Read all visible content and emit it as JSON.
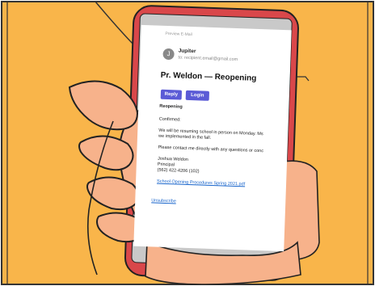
{
  "email": {
    "subtitle": "Preview E-Mail",
    "avatar_letter": "J",
    "sender": "Jupiter",
    "to": "to: recipient.email@gmail.com",
    "subject": "Pr. Weldon — Reopening",
    "buttons": {
      "reply": "Reply",
      "login": "Login"
    },
    "heading": "Reopening",
    "confirmed": "Confirmed:",
    "body_line1": "We will be resuming school in person on Monday. Ms",
    "body_line2": "we implemented in the fall.",
    "contact": "Please contact me directly with any questions or conc",
    "signature": {
      "name": "Joshua Weldon",
      "title": "Principal",
      "phone": "(562) 422-4206 (102)"
    },
    "attachment": "School Opening Procedures Spring 2021.pdf",
    "unsubscribe": "Unsubscribe"
  },
  "colors": {
    "background": "#F9B54A",
    "phone": "#D9474A",
    "hand": "#F7B28B",
    "button": "#5B5BD6",
    "link": "#1A66CC"
  }
}
